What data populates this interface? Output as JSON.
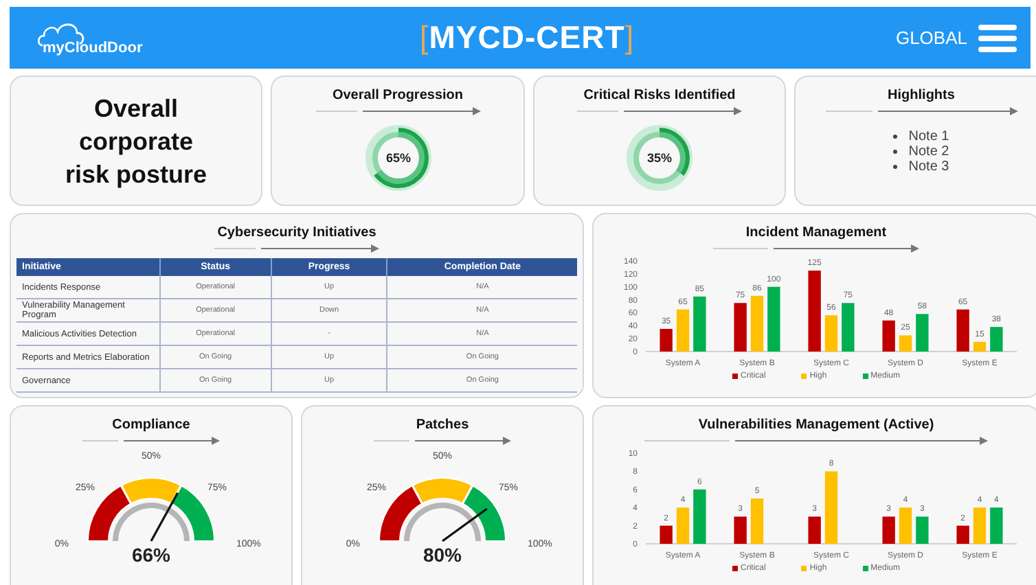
{
  "header": {
    "logo_text": "myCloudDoor",
    "title_open": "[",
    "title": "MYCD-CERT",
    "title_close": "]",
    "scope": "GLOBAL"
  },
  "posture": {
    "text": "Overall corporate risk posture"
  },
  "donuts": [
    {
      "title": "Overall Progression",
      "reading": "65%"
    },
    {
      "title": "Critical Risks Identified",
      "reading": "35%"
    }
  ],
  "highlights": {
    "title": "Highlights",
    "notes": [
      "Note 1",
      "Note 2",
      "Note 3"
    ]
  },
  "initiatives": {
    "title": "Cybersecurity Initiatives",
    "columns": [
      "Initiative",
      "Status",
      "Progress",
      "Completion Date"
    ],
    "rows": [
      [
        "Incidents Response",
        "Operational",
        "Up",
        "N/A"
      ],
      [
        "Vulnerability Management Program",
        "Operational",
        "Down",
        "N/A"
      ],
      [
        "Malicious Activities Detection",
        "Operational",
        "-",
        "N/A"
      ],
      [
        "Reports and Metrics Elaboration",
        "On Going",
        "Up",
        "On Going"
      ],
      [
        "Governance",
        "On Going",
        "Up",
        "On Going"
      ]
    ]
  },
  "incidents": {
    "title": "Incident Management",
    "chart_data": {
      "type": "bar",
      "categories": [
        "System A",
        "System B",
        "System C",
        "System D",
        "System E"
      ],
      "series": [
        {
          "name": "Critical",
          "color": "#c00000",
          "values": [
            35,
            75,
            125,
            48,
            65
          ]
        },
        {
          "name": "High",
          "color": "#ffc000",
          "values": [
            65,
            86,
            56,
            25,
            15
          ]
        },
        {
          "name": "Medium",
          "color": "#00b050",
          "values": [
            85,
            100,
            75,
            58,
            38
          ]
        }
      ],
      "ylim": [
        0,
        140
      ],
      "yticks": [
        0,
        20,
        40,
        60,
        80,
        100,
        120,
        140
      ],
      "data_labels": true,
      "legend": "bottom"
    }
  },
  "gauges": [
    {
      "title": "Compliance",
      "reading": "66%",
      "ticks": [
        "0%",
        "25%",
        "50%",
        "75%",
        "100%"
      ]
    },
    {
      "title": "Patches",
      "reading": "80%",
      "ticks": [
        "0%",
        "25%",
        "50%",
        "75%",
        "100%"
      ]
    }
  ],
  "vulnerabilities": {
    "title": "Vulnerabilities  Management (Active)",
    "chart_data": {
      "type": "bar",
      "categories": [
        "System A",
        "System B",
        "System C",
        "System D",
        "System E"
      ],
      "series": [
        {
          "name": "Critical",
          "color": "#c00000",
          "values": [
            2,
            3,
            3,
            3,
            2
          ]
        },
        {
          "name": "High",
          "color": "#ffc000",
          "values": [
            4,
            5,
            8,
            4,
            4
          ]
        },
        {
          "name": "Medium",
          "color": "#00b050",
          "values": [
            6,
            null,
            null,
            3,
            4
          ]
        }
      ],
      "ylim": [
        0,
        10
      ],
      "yticks": [
        0,
        2,
        4,
        6,
        8,
        10
      ],
      "data_labels": true,
      "legend": "bottom"
    }
  }
}
